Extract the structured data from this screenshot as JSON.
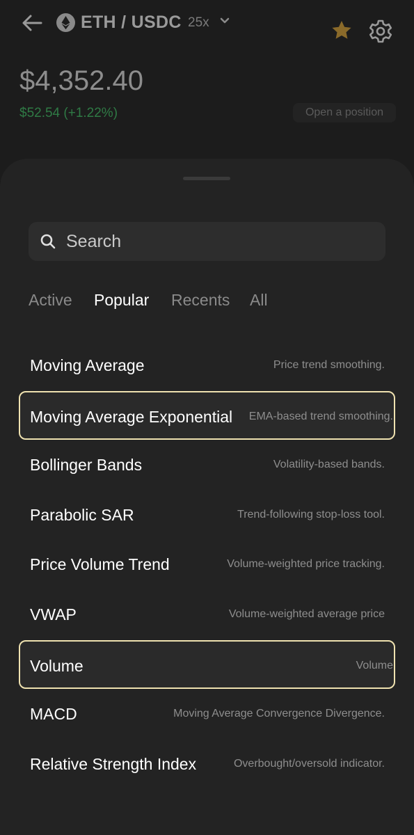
{
  "header": {
    "pair": "ETH / USDC",
    "leverage": "25x",
    "icons": [
      "back-arrow-icon",
      "eth-coin-icon",
      "chevron-down-icon",
      "star-icon",
      "gear-icon"
    ],
    "favorite_color": "#8a6a2a"
  },
  "market": {
    "price": "$4,352.40",
    "change": "$52.54 (+1.22%)",
    "change_color": "#2f7a45",
    "open_position_label": "Open a position"
  },
  "sheet": {
    "search_placeholder": "Search",
    "tabs": [
      {
        "label": "Active"
      },
      {
        "label": "Popular",
        "selected": true
      },
      {
        "label": "Recents"
      },
      {
        "label": "All"
      }
    ],
    "indicators": [
      {
        "name": "Moving Average",
        "desc": "Price trend smoothing.",
        "highlighted": false
      },
      {
        "name": "Moving Average Exponential",
        "desc": "EMA-based trend smoothing.",
        "highlighted": true
      },
      {
        "name": "Bollinger Bands",
        "desc": "Volatility-based bands.",
        "highlighted": false
      },
      {
        "name": "Parabolic SAR",
        "desc": "Trend-following stop-loss tool.",
        "highlighted": false
      },
      {
        "name": "Price Volume Trend",
        "desc": "Volume-weighted price tracking.",
        "highlighted": false
      },
      {
        "name": "VWAP",
        "desc": "Volume-weighted average price",
        "highlighted": false
      },
      {
        "name": "Volume",
        "desc": "Volume",
        "highlighted": true
      },
      {
        "name": "MACD",
        "desc": "Moving Average Convergence Divergence.",
        "highlighted": false
      },
      {
        "name": "Relative Strength Index",
        "desc": "Overbought/oversold indicator.",
        "highlighted": false
      }
    ],
    "highlight_color": "#efe2b0"
  }
}
